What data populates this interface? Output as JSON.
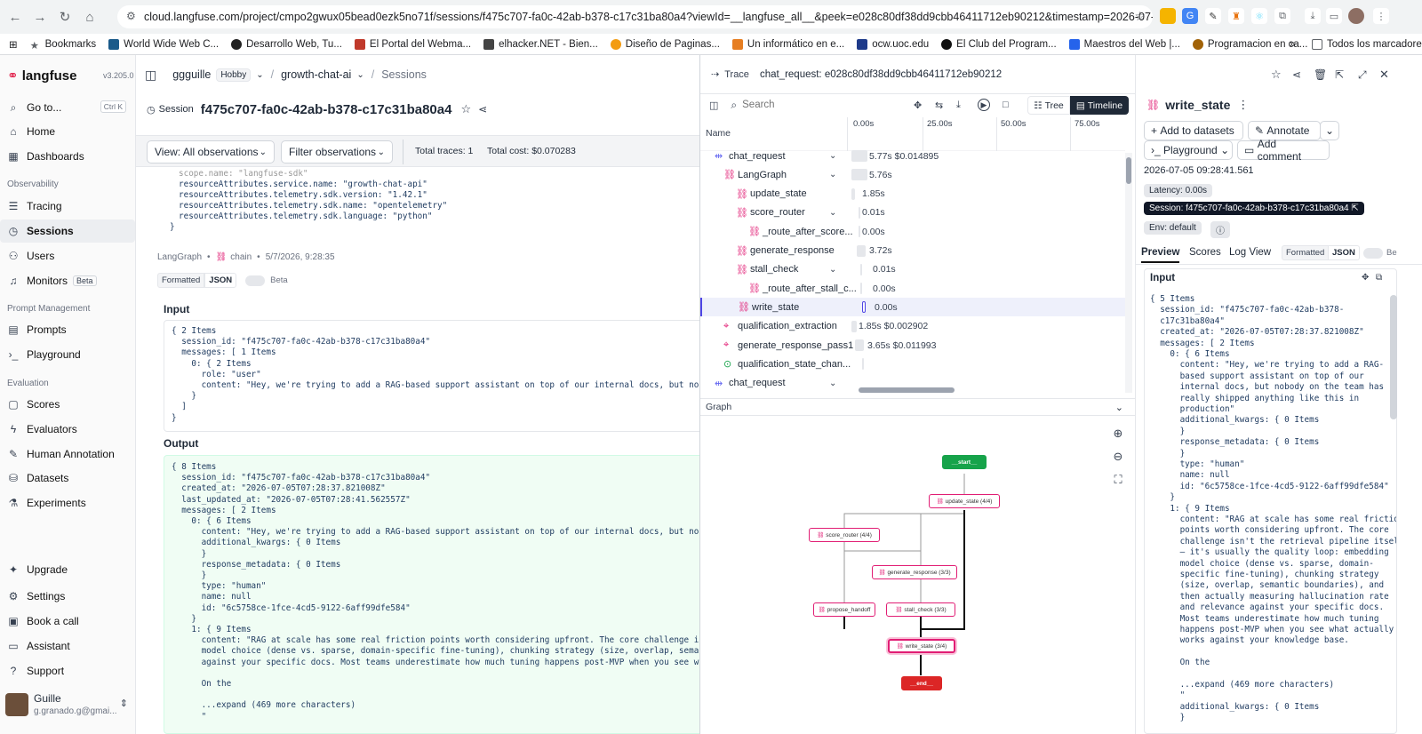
{
  "browser": {
    "url": "cloud.langfuse.com/project/cmpo2gwux05bead0ezk5no71f/sessions/f475c707-fa0c-42ab-b378-c17c31ba80a4?viewId=__langfuse_all__&peek=e028c80df38dd9cbb46411712eb90212&timestamp=2026-07-05T07%...",
    "bookmarks": [
      "Bookmarks",
      "World Wide Web C...",
      "Desarrollo Web, Tu...",
      "El Portal del Webma...",
      "elhacker.NET - Bien...",
      "Diseño de Paginas...",
      "Un informático en e...",
      "ocw.uoc.edu",
      "El Club del Program...",
      "Maestros del Web |...",
      "Programacion en ca..."
    ],
    "all_bookmarks": "Todos los marcadores"
  },
  "sidebar": {
    "logo": "langfuse",
    "version": "v3.205.0",
    "goto": "Go to...",
    "goto_kbd": "Ctrl K",
    "items_top": [
      "Home",
      "Dashboards"
    ],
    "section_observability": "Observability",
    "items_obs": [
      "Tracing",
      "Sessions",
      "Users",
      "Monitors"
    ],
    "monitors_badge": "Beta",
    "section_prompt": "Prompt Management",
    "items_prompt": [
      "Prompts",
      "Playground"
    ],
    "section_eval": "Evaluation",
    "items_eval": [
      "Scores",
      "Evaluators",
      "Human Annotation",
      "Datasets",
      "Experiments"
    ],
    "items_bottom": [
      "Upgrade",
      "Settings",
      "Book a call",
      "Assistant",
      "Support"
    ],
    "user_name": "Guille",
    "user_email": "g.granado.g@gmai..."
  },
  "header": {
    "org": "ggguille",
    "plan": "Hobby",
    "project": "growth-chat-ai",
    "page": "Sessions",
    "session_label": "Session",
    "session_id": "f475c707-fa0c-42ab-b378-c17c31ba80a4"
  },
  "toolbar": {
    "view": "View: All observations",
    "filter": "Filter observations",
    "total_traces": "Total traces: 1",
    "total_cost": "Total cost: $0.070283"
  },
  "main": {
    "attrs": [
      "scope.name: \"langfuse-sdk\"",
      "resourceAttributes.service.name: \"growth-chat-api\"",
      "resourceAttributes.telemetry.sdk.version: \"1.42.1\"",
      "resourceAttributes.telemetry.sdk.name: \"opentelemetry\"",
      "resourceAttributes.telemetry.sdk.language: \"python\"",
      "}"
    ],
    "obs_name": "LangGraph",
    "obs_type": "chain",
    "obs_time": "5/7/2026, 9:28:35",
    "fmt_formatted": "Formatted",
    "fmt_json": "JSON",
    "fmt_beta": "Beta",
    "input_title": "Input",
    "input_lines": [
      "{ 2 Items",
      "  session_id: \"f475c707-fa0c-42ab-b378-c17c31ba80a4\"",
      "  messages: [ 1 Items",
      "    0: { 2 Items",
      "      role: \"user\"",
      "      content: \"Hey, we're trying to add a RAG-based support assistant on top of our internal docs, but nobody on the t",
      "    }",
      "  ]",
      "}"
    ],
    "output_title": "Output",
    "output_lines": [
      "{ 8 Items",
      "  session_id: \"f475c707-fa0c-42ab-b378-c17c31ba80a4\"",
      "  created_at: \"2026-07-05T07:28:37.821008Z\"",
      "  last_updated_at: \"2026-07-05T07:28:41.562557Z\"",
      "  messages: [ 2 Items",
      "    0: { 6 Items",
      "      content: \"Hey, we're trying to add a RAG-based support assistant on top of our internal docs, but nobody on the t",
      "      additional_kwargs: { 0 Items",
      "      }",
      "      response_metadata: { 0 Items",
      "      }",
      "      type: \"human\"",
      "      name: null",
      "      id: \"6c5758ce-1fce-4cd5-9122-6aff99dfe584\"",
      "    }",
      "    1: { 9 Items",
      "      content: \"RAG at scale has some real friction points worth considering upfront. The core challenge isn't the retr",
      "      model choice (dense vs. sparse, domain-specific fine-tuning), chunking strategy (size, overlap, semantic boundari",
      "      against your specific docs. Most teams underestimate how much tuning happens post-MVP when you see what actually",
      "",
      "      On the",
      "",
      "      ...expand (469 more characters)",
      "      \""
    ]
  },
  "trace": {
    "label": "Trace",
    "title": "chat_request: e028c80df38dd9cbb46411712eb90212",
    "search_placeholder": "Search",
    "view_tree": "Tree",
    "view_timeline": "Timeline",
    "col_name": "Name",
    "ticks": [
      "0.00s",
      "25.00s",
      "50.00s",
      "75.00s"
    ],
    "rows": [
      {
        "name": "chat_request",
        "val": "5.77s  $0.014895"
      },
      {
        "name": "LangGraph",
        "val": "5.76s"
      },
      {
        "name": "update_state",
        "val": "1.85s"
      },
      {
        "name": "score_router",
        "val": "0.01s"
      },
      {
        "name": "_route_after_score...",
        "val": "0.00s"
      },
      {
        "name": "generate_response",
        "val": "3.72s"
      },
      {
        "name": "stall_check",
        "val": "0.01s"
      },
      {
        "name": "_route_after_stall_c...",
        "val": "0.00s"
      },
      {
        "name": "write_state",
        "val": "0.00s"
      },
      {
        "name": "qualification_extraction",
        "val": "1.85s  $0.002902"
      },
      {
        "name": "generate_response_pass1",
        "val": "3.65s  $0.011993"
      },
      {
        "name": "qualification_state_chan...",
        "val": ""
      },
      {
        "name": "chat_request",
        "val": ""
      }
    ],
    "graph_label": "Graph",
    "nodes": {
      "start": "__start__",
      "update_state": "update_state (4/4)",
      "score_router": "score_router (4/4)",
      "generate_response": "generate_response (3/3)",
      "propose_handoff": "propose_handoff",
      "stall_check": "stall_check (3/3)",
      "write_state": "write_state (3/4)",
      "end": "__end__"
    }
  },
  "detail": {
    "title": "write_state",
    "add_datasets": "Add to datasets",
    "annotate": "Annotate",
    "playground": "Playground",
    "add_comment": "Add comment",
    "timestamp": "2026-07-05 09:28:41.561",
    "latency": "Latency: 0.00s",
    "session": "Session: f475c707-fa0c-42ab-b378-c17c31ba80a4",
    "env": "Env: default",
    "tabs": [
      "Preview",
      "Scores",
      "Log View"
    ],
    "fmt_formatted": "Formatted",
    "fmt_json": "JSON",
    "fmt_beta": "Be",
    "input_title": "Input",
    "lines": [
      "{ 5 Items",
      "  session_id: \"f475c707-fa0c-42ab-b378-",
      "  c17c31ba80a4\"",
      "  created_at: \"2026-07-05T07:28:37.821008Z\"",
      "  messages: [ 2 Items",
      "    0: { 6 Items",
      "      content: \"Hey, we're trying to add a RAG-",
      "      based support assistant on top of our",
      "      internal docs, but nobody on the team has",
      "      really shipped anything like this in",
      "      production\"",
      "      additional_kwargs: { 0 Items",
      "      }",
      "      response_metadata: { 0 Items",
      "      }",
      "      type: \"human\"",
      "      name: null",
      "      id: \"6c5758ce-1fce-4cd5-9122-6aff99dfe584\"",
      "    }",
      "    1: { 9 Items",
      "      content: \"RAG at scale has some real friction",
      "      points worth considering upfront. The core",
      "      challenge isn't the retrieval pipeline itself",
      "      — it's usually the quality loop: embedding",
      "      model choice (dense vs. sparse, domain-",
      "      specific fine-tuning), chunking strategy",
      "      (size, overlap, semantic boundaries), and",
      "      then actually measuring hallucination rate",
      "      and relevance against your specific docs.",
      "      Most teams underestimate how much tuning",
      "      happens post-MVP when you see what actually",
      "      works against your knowledge base.",
      "",
      "      On the",
      "",
      "      ...expand (469 more characters)",
      "      \"",
      "      additional_kwargs: { 0 Items",
      "      }"
    ]
  }
}
